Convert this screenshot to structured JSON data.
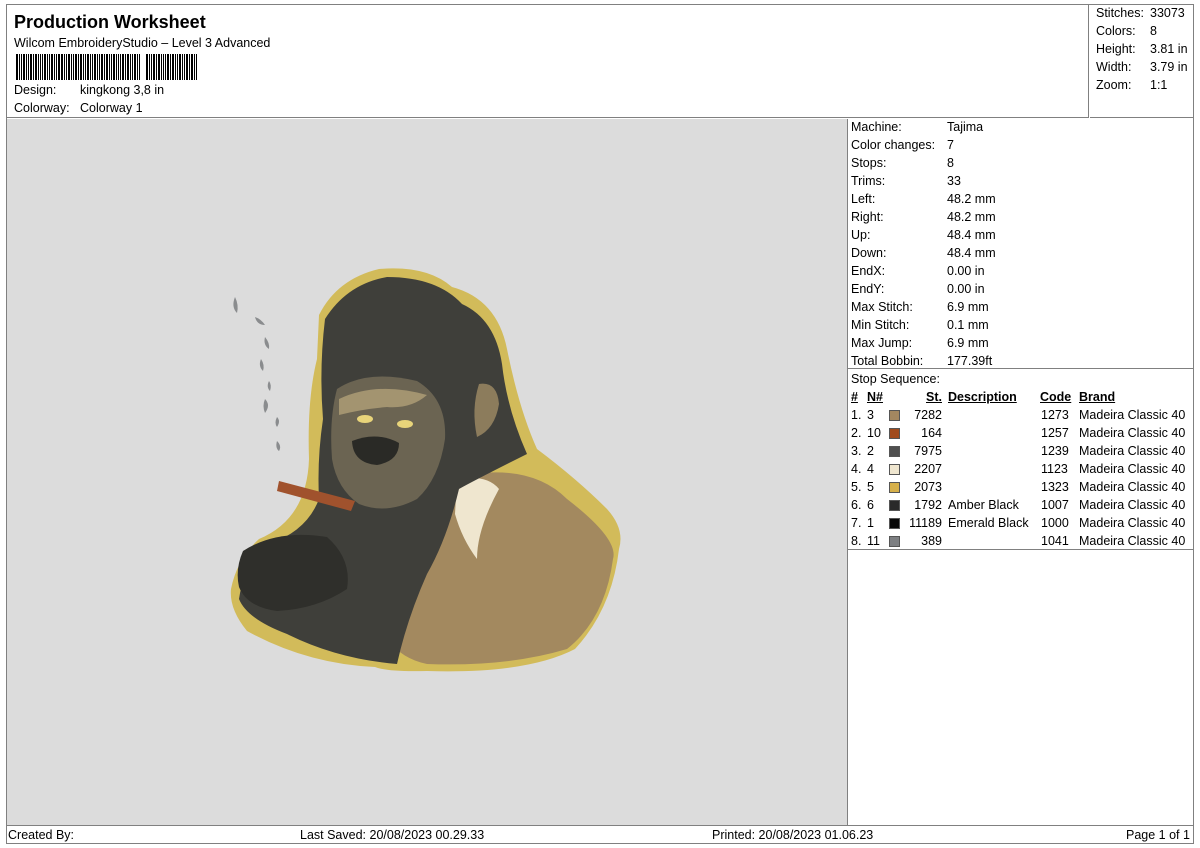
{
  "header": {
    "title": "Production Worksheet",
    "software": "Wilcom EmbroideryStudio – Level 3 Advanced",
    "design_label": "Design:",
    "design_value": "kingkong 3,8 in",
    "colorway_label": "Colorway:",
    "colorway_value": "Colorway 1"
  },
  "summary": {
    "stitches_label": "Stitches:",
    "stitches_value": "33073",
    "colors_label": "Colors:",
    "colors_value": "8",
    "height_label": "Height:",
    "height_value": "3.81 in",
    "width_label": "Width:",
    "width_value": "3.79 in",
    "zoom_label": "Zoom:",
    "zoom_value": "1:1"
  },
  "machine": [
    {
      "k": "Machine:",
      "v": "Tajima"
    },
    {
      "k": "Color changes:",
      "v": "7"
    },
    {
      "k": "Stops:",
      "v": "8"
    },
    {
      "k": "Trims:",
      "v": "33"
    },
    {
      "k": "Left:",
      "v": "48.2 mm"
    },
    {
      "k": "Right:",
      "v": "48.2 mm"
    },
    {
      "k": "Up:",
      "v": "48.4 mm"
    },
    {
      "k": "Down:",
      "v": "48.4 mm"
    },
    {
      "k": "EndX:",
      "v": "0.00 in"
    },
    {
      "k": "EndY:",
      "v": "0.00 in"
    },
    {
      "k": "Max Stitch:",
      "v": "6.9 mm"
    },
    {
      "k": "Min Stitch:",
      "v": "0.1 mm"
    },
    {
      "k": "Max Jump:",
      "v": "6.9 mm"
    },
    {
      "k": "Total Bobbin:",
      "v": "177.39ft"
    }
  ],
  "stop_sequence": {
    "title": "Stop Sequence:",
    "headers": {
      "num": "#",
      "n": "N#",
      "st": "St.",
      "desc": "Description",
      "code": "Code",
      "brand": "Brand"
    },
    "rows": [
      {
        "idx": "1.",
        "n": "3",
        "color": "#a38760",
        "st": "7282",
        "desc": "",
        "code": "1273",
        "brand": "Madeira Classic 40"
      },
      {
        "idx": "2.",
        "n": "10",
        "color": "#a04a1c",
        "st": "164",
        "desc": "",
        "code": "1257",
        "brand": "Madeira Classic 40"
      },
      {
        "idx": "3.",
        "n": "2",
        "color": "#4f4f4f",
        "st": "7975",
        "desc": "",
        "code": "1239",
        "brand": "Madeira Classic 40"
      },
      {
        "idx": "4.",
        "n": "4",
        "color": "#efe6cf",
        "st": "2207",
        "desc": "",
        "code": "1123",
        "brand": "Madeira Classic 40"
      },
      {
        "idx": "5.",
        "n": "5",
        "color": "#d6b04a",
        "st": "2073",
        "desc": "",
        "code": "1323",
        "brand": "Madeira Classic 40"
      },
      {
        "idx": "6.",
        "n": "6",
        "color": "#2a2a2a",
        "st": "1792",
        "desc": "Amber Black",
        "code": "1007",
        "brand": "Madeira Classic 40"
      },
      {
        "idx": "7.",
        "n": "1",
        "color": "#080808",
        "st": "11189",
        "desc": "Emerald Black",
        "code": "1000",
        "brand": "Madeira Classic 40"
      },
      {
        "idx": "8.",
        "n": "11",
        "color": "#7d7f82",
        "st": "389",
        "desc": "",
        "code": "1041",
        "brand": "Madeira Classic 40"
      }
    ]
  },
  "footer": {
    "created_by": "Created By:",
    "last_saved": "Last Saved: 20/08/2023 00.29.33",
    "printed": "Printed: 20/08/2023 01.06.23",
    "page": "Page 1 of 1"
  }
}
